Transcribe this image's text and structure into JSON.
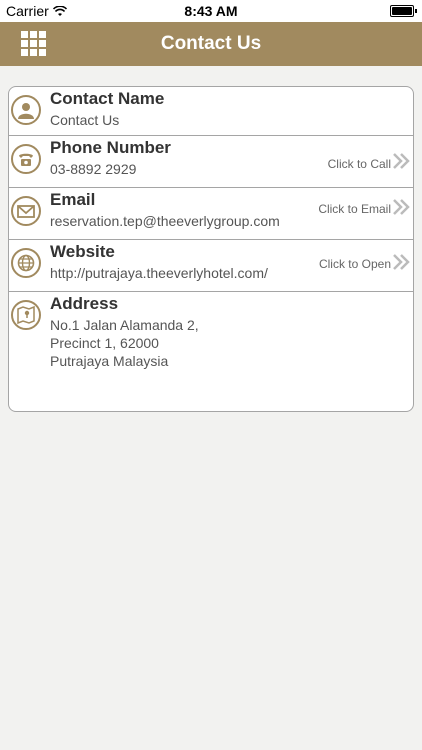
{
  "status": {
    "carrier": "Carrier",
    "time": "8:43 AM"
  },
  "nav": {
    "title": "Contact Us"
  },
  "rows": [
    {
      "label": "Contact Name",
      "value": "Contact Us",
      "action": ""
    },
    {
      "label": "Phone Number",
      "value": "03-8892 2929",
      "action": "Click to Call"
    },
    {
      "label": "Email",
      "value": "reservation.tep@theeverlygroup.com",
      "action": "Click to Email"
    },
    {
      "label": "Website",
      "value": "http://putrajaya.theeverlyhotel.com/",
      "action": "Click to Open"
    },
    {
      "label": "Address",
      "value": "No.1 Jalan Alamanda 2,\nPrecinct 1, 62000\nPutrajaya Malaysia",
      "action": ""
    }
  ],
  "colors": {
    "accent": "#a18a5f",
    "border": "#a5a5a5",
    "background": "#f2f2f0"
  }
}
